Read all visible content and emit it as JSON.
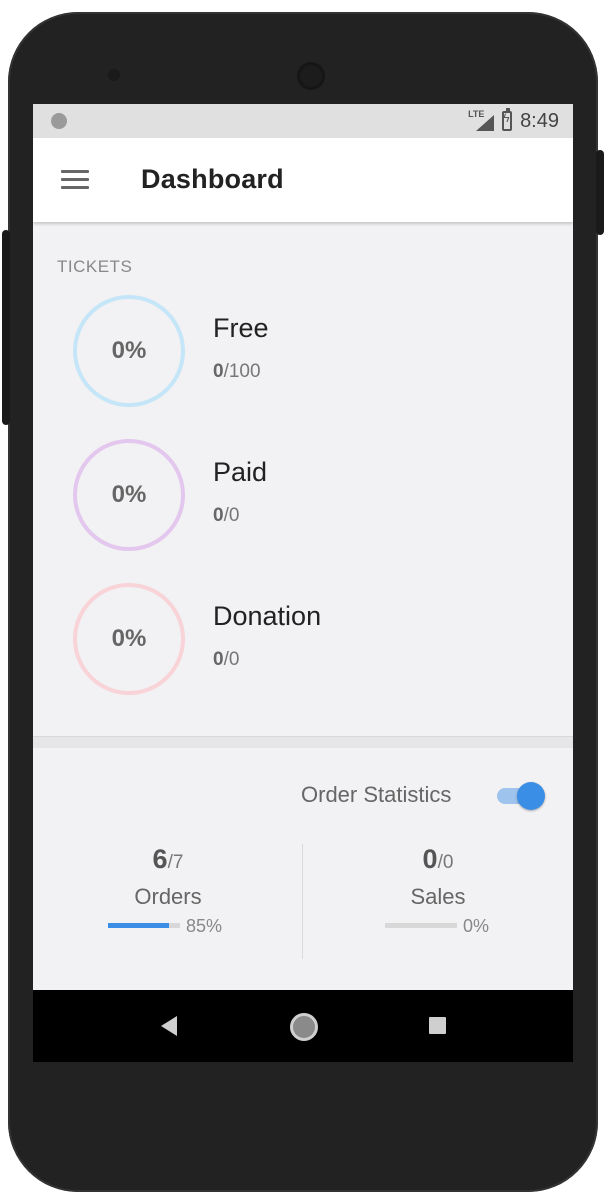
{
  "status_bar": {
    "network": "LTE",
    "time": "8:49"
  },
  "app_bar": {
    "title": "Dashboard",
    "menu_icon": "hamburger-menu-icon"
  },
  "tickets": {
    "section_label": "TICKETS",
    "items": [
      {
        "name": "Free",
        "percent": "0%",
        "sold": "0",
        "total": "/100",
        "ring_color": "#c5e6f8"
      },
      {
        "name": "Paid",
        "percent": "0%",
        "sold": "0",
        "total": "/0",
        "ring_color": "#e3c7ee"
      },
      {
        "name": "Donation",
        "percent": "0%",
        "sold": "0",
        "total": "/0",
        "ring_color": "#f8d3d8"
      }
    ]
  },
  "order_statistics": {
    "label": "Order Statistics",
    "toggle_on": true,
    "accent": "#3b8ee6",
    "orders": {
      "value": "6",
      "total": "/7",
      "label": "Orders",
      "percent": "85%",
      "fill": 0.85
    },
    "sales": {
      "value": "0",
      "total": "/0",
      "label": "Sales",
      "percent": "0%",
      "fill": 0.0
    }
  },
  "nav_bar": {
    "icons": [
      "back-icon",
      "home-icon",
      "recents-icon"
    ]
  }
}
